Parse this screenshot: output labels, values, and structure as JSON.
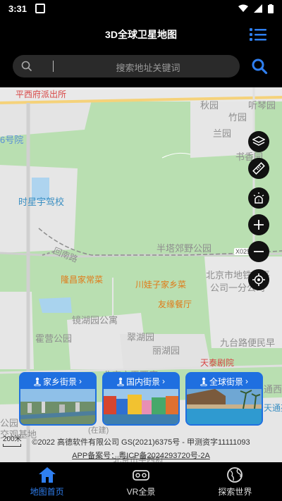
{
  "status_bar": {
    "time": "3:31"
  },
  "header": {
    "title": "3D全球卫星地图"
  },
  "search": {
    "placeholder": "搜索地址关键词"
  },
  "map": {
    "labels": [
      "平西府派出所",
      "秋园",
      "听琴园",
      "竹园",
      "兰园",
      "6号院",
      "书香园",
      "时星宇驾校",
      "回南路",
      "半塔郊野公园",
      "X025",
      "北京市地铁昌平",
      "公司一分公司",
      "隆昌家常菜",
      "川娃子家乡菜",
      "友缘餐厅",
      "镜湖园公寓",
      "霍营公园",
      "翠湖园",
      "丽湖园",
      "九台路便民早",
      "天泰剧院",
      "北京市平西府",
      "通西",
      "天通苑",
      "公园",
      "交观基地",
      "(在建)",
      "北京市平西府"
    ],
    "scale": "200米",
    "copyright": "©2022 高德软件有限公司 GS(2021)6375号 - 甲测资字11111093",
    "icp": "APP备案号：粤ICP备2024293720号-2A"
  },
  "street_view_cards": [
    {
      "label": "家乡街景"
    },
    {
      "label": "国内街景"
    },
    {
      "label": "全球街景"
    }
  ],
  "bottom_nav": [
    {
      "label": "地图首页",
      "active": true
    },
    {
      "label": "VR全景",
      "active": false
    },
    {
      "label": "探索世界",
      "active": false
    }
  ],
  "colors": {
    "accent": "#2f7ff0",
    "card_blue": "#1f6fe0",
    "map_green": "#b9dfb1"
  }
}
